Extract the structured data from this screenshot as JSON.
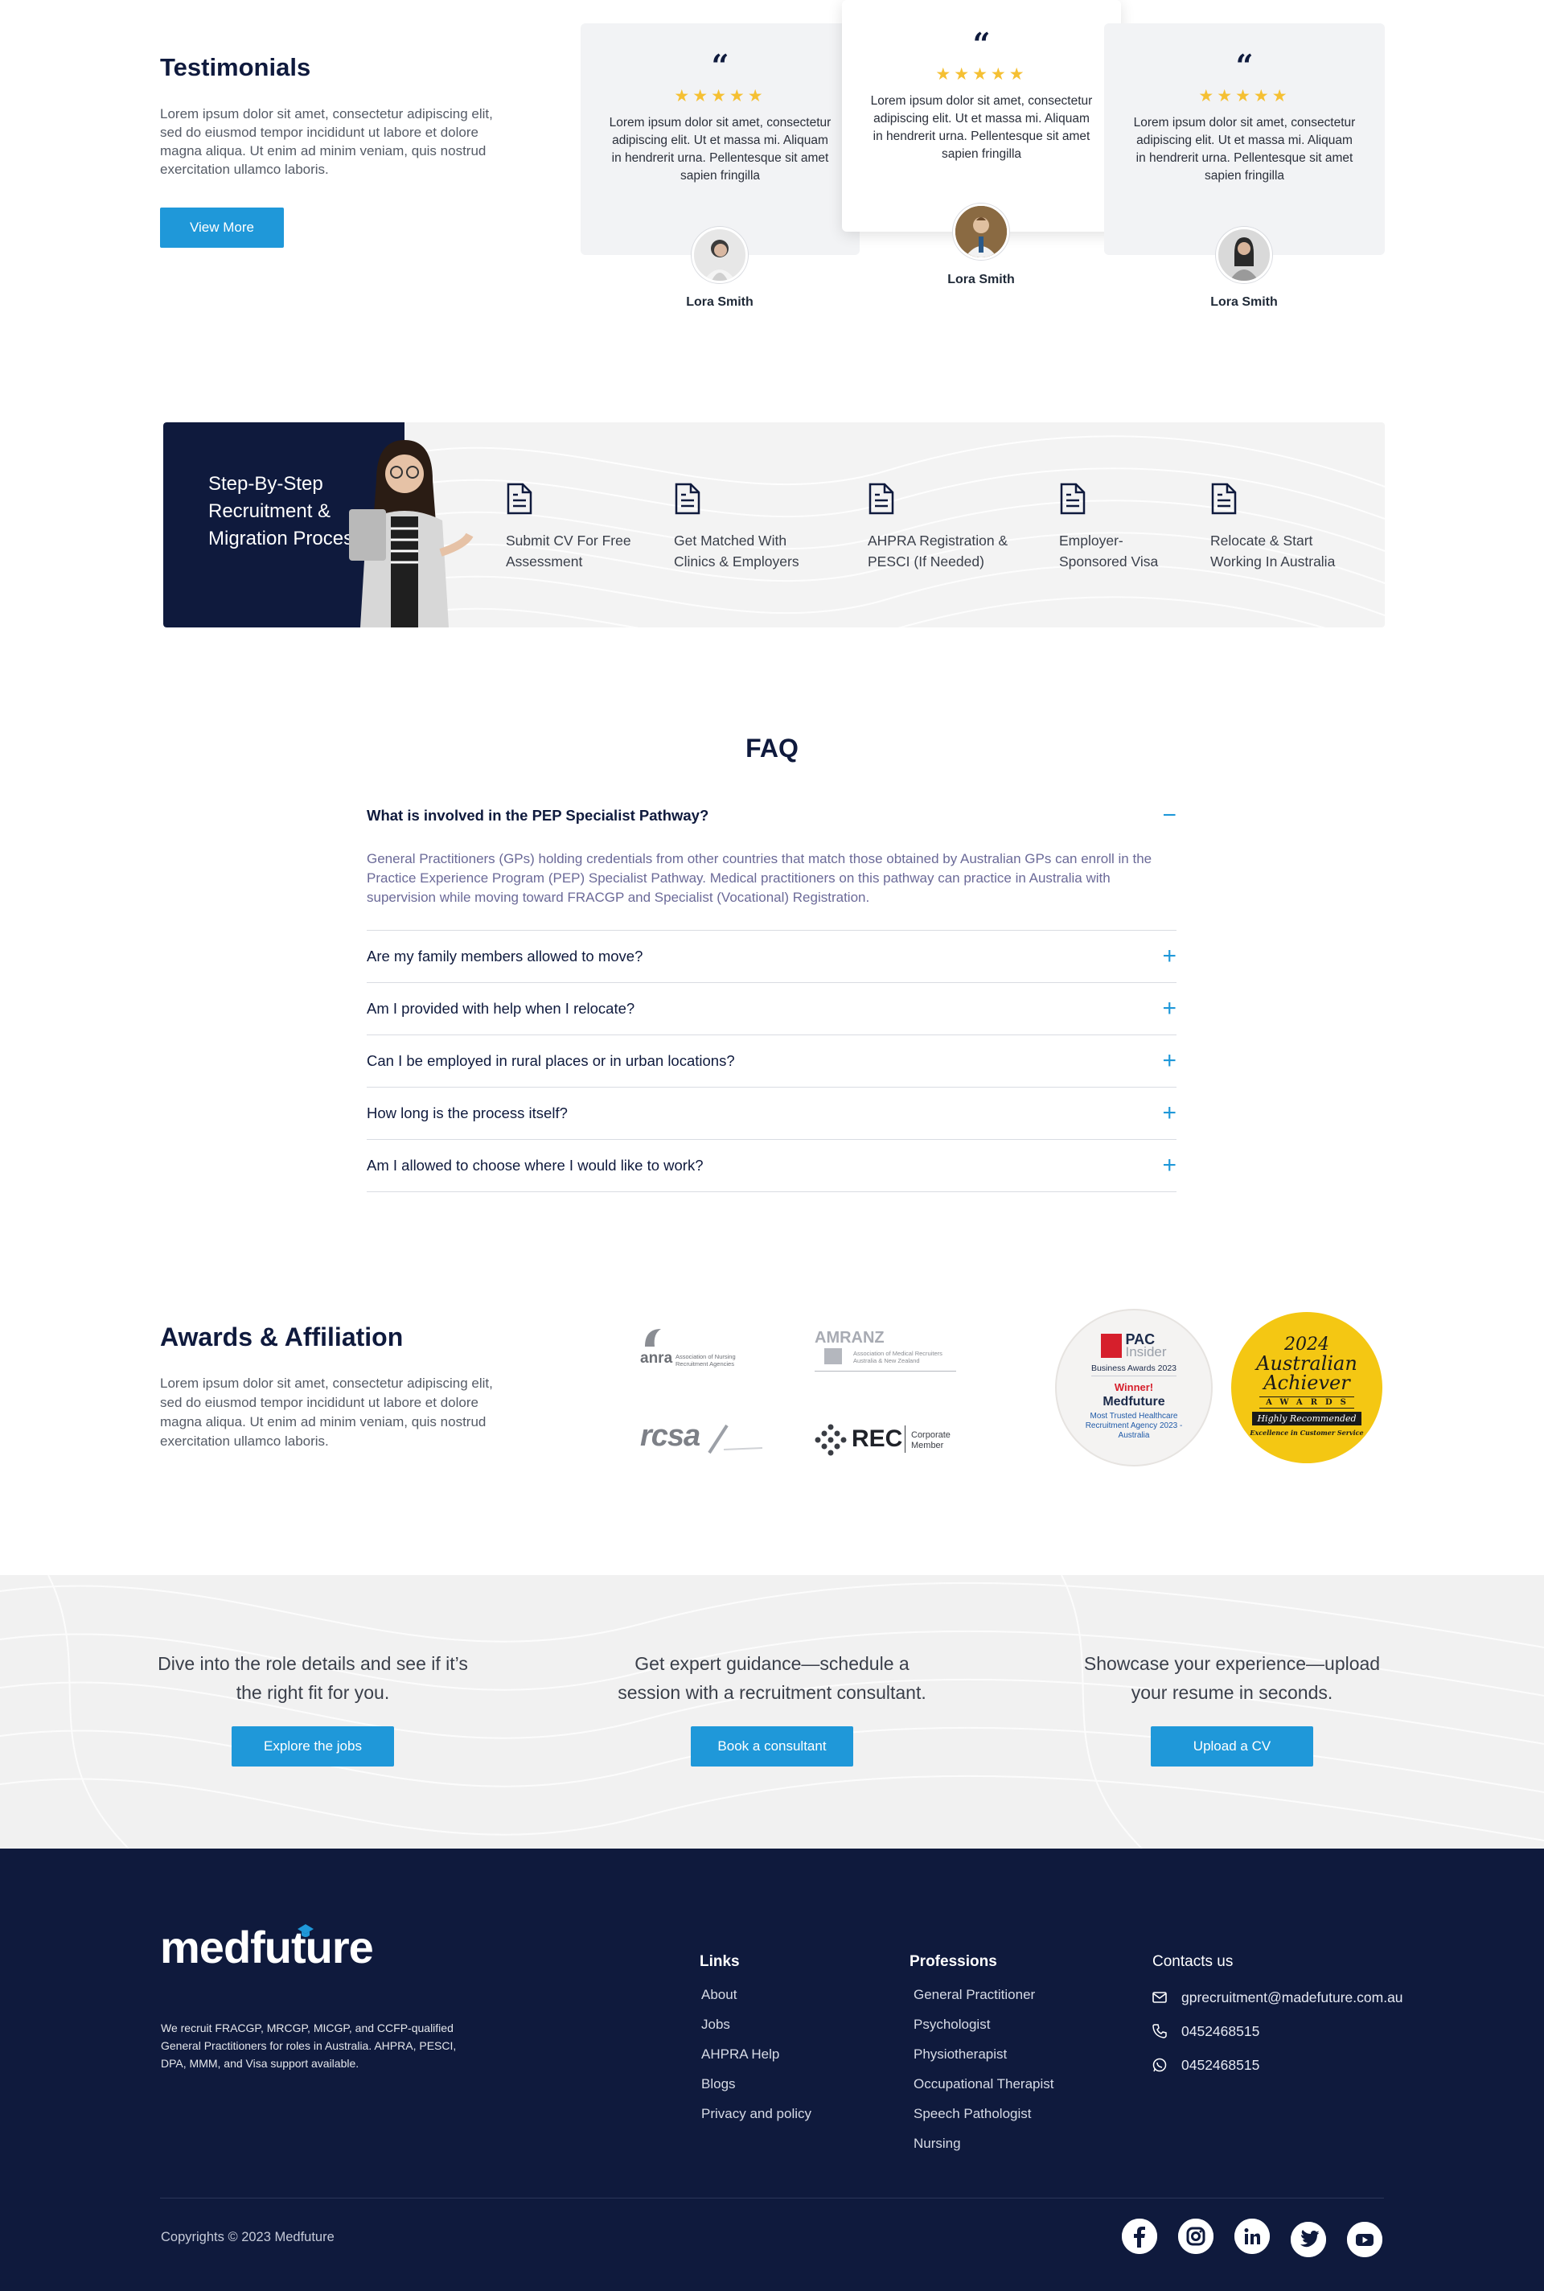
{
  "testimonials": {
    "title": "Testimonials",
    "description": "Lorem ipsum dolor sit amet, consectetur adipiscing elit, sed do eiusmod tempor incididunt ut labore et dolore magna aliqua. Ut enim ad minim veniam, quis nostrud exercitation ullamco laboris.",
    "view_more": "View More",
    "quote_mark": "“",
    "stars": "★★★★★",
    "cards": [
      {
        "text": "Lorem ipsum dolor sit amet, consectetur adipiscing elit. Ut et massa mi. Aliquam in hendrerit urna. Pellentesque sit amet sapien fringilla",
        "name": "Lora Smith"
      },
      {
        "text": "Lorem ipsum dolor sit amet, consectetur adipiscing elit. Ut et massa mi. Aliquam in hendrerit urna. Pellentesque sit amet sapien fringilla",
        "name": "Lora Smith"
      },
      {
        "text": "Lorem ipsum dolor sit amet, consectetur adipiscing elit. Ut et massa mi. Aliquam in hendrerit urna. Pellentesque sit amet sapien fringilla",
        "name": "Lora Smith"
      }
    ]
  },
  "process": {
    "title": "Step-By-Step Recruitment & Migration Process",
    "steps": [
      {
        "label": "Submit CV For Free Assessment",
        "icon": "document-icon"
      },
      {
        "label": "Get Matched With Clinics & Employers",
        "icon": "document-icon"
      },
      {
        "label": "AHPRA Registration & PESCI (If Needed)",
        "icon": "document-icon"
      },
      {
        "label": "Employer-Sponsored Visa",
        "icon": "document-icon"
      },
      {
        "label": "Relocate & Start Working In Australia",
        "icon": "document-icon"
      }
    ]
  },
  "faq": {
    "title": "FAQ",
    "open_question": "What is involved in the PEP Specialist Pathway?",
    "open_answer": "General Practitioners (GPs) holding credentials from other countries that match those obtained by Australian GPs can enroll in the Practice Experience Program (PEP) Specialist Pathway. Medical practitioners on this pathway can practice in Australia with supervision while moving toward FRACGP and Specialist (Vocational) Registration.",
    "collapse_icon": "−",
    "expand_icon": "+",
    "questions": [
      "Are my family members allowed to move?",
      "Am I provided with help when I relocate?",
      "Can I be employed in rural places or in urban locations?",
      "How long is the process itself?",
      "Am I allowed to choose where I would like to work?"
    ]
  },
  "awards": {
    "title": "Awards & Affiliation",
    "description": "Lorem ipsum dolor sit amet, consectetur adipiscing elit, sed do eiusmod tempor incididunt ut labore et dolore magna aliqua. Ut enim ad minim veniam, quis nostrud exercitation ullamco laboris.",
    "logos": {
      "anra": {
        "name": "anra",
        "sub": "Association of Nursing Recruitment Agencies"
      },
      "amranz": {
        "name": "AMRANZ",
        "sub": "Association of Medical Recruiters Australia & New Zealand"
      },
      "rcsa": {
        "name": "rcsa"
      },
      "rec": {
        "name": "REC",
        "sub": "Corporate Member"
      }
    },
    "pac": {
      "brand": "PAC",
      "brand2": "Insider",
      "line1": "Business Awards 2023",
      "winner": "Winner!",
      "company": "Medfuture",
      "award": "Most Trusted Healthcare Recruitment Agency 2023 - Australia"
    },
    "achiever": {
      "year": "2024",
      "line1": "Australian",
      "line2": "Achiever",
      "awards": "AWARDS",
      "recommended": "Highly Recommended",
      "footer": "Excellence in Customer Service"
    }
  },
  "cta": [
    {
      "text": "Dive into the role details and see if it’s the right fit for you.",
      "button": "Explore the jobs"
    },
    {
      "text": "Get expert guidance—schedule a session with a recruitment consultant.",
      "button": "Book a consultant"
    },
    {
      "text": "Showcase your experience—upload your resume in seconds.",
      "button": "Upload a CV"
    }
  ],
  "footer": {
    "logo": "medfuture",
    "description": "We recruit FRACGP, MRCGP, MICGP, and CCFP-qualified General Practitioners for roles in Australia. AHPRA, PESCI, DPA, MMM, and Visa support available.",
    "links_title": "Links",
    "links": [
      "About",
      "Jobs",
      "AHPRA Help",
      "Blogs",
      "Privacy and policy"
    ],
    "professions_title": "Professions",
    "professions": [
      "General Practitioner",
      "Psychologist",
      "Physiotherapist",
      "Occupational Therapist",
      "Speech Pathologist",
      "Nursing"
    ],
    "contacts_title": "Contacts us",
    "email": "gprecruitment@madefuture.com.au",
    "phone": "0452468515",
    "whatsapp": "0452468515",
    "copyright": "Copyrights © 2023 Medfuture",
    "social": [
      "facebook-icon",
      "instagram-icon",
      "linkedin-icon",
      "twitter-icon",
      "youtube-icon"
    ]
  },
  "colors": {
    "navy": "#0f1a3d",
    "accent": "#1f98d9",
    "star": "#f5c033"
  }
}
